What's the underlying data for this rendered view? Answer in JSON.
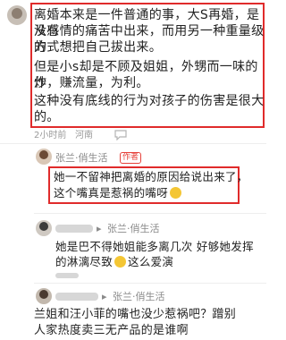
{
  "comment1": {
    "lines": [
      "离婚本来是一件普通的事，大S再婚，是没有",
      "从感情的痛苦中出来，而用另一种重量级的",
      "方式想把自己拔出来。",
      "但是小s却是不顾及姐姐，外甥而一味的炒",
      "作，赚流量，为利。",
      "这种没有底线的行为对孩子的伤害是很大",
      "的。"
    ],
    "time": "2小时前",
    "location": "河南"
  },
  "reply1": {
    "name": "张兰·俏生活",
    "badge": "作者",
    "lines": [
      "她一不留神把离婚的原因给说出来了，",
      "这个嘴真是惹祸的嘴呀"
    ]
  },
  "reply2": {
    "arrow": "▸",
    "name": "张兰·俏生活",
    "lines": [
      "她是巴不得她姐能多离几次 好够她发挥",
      "的淋漓尽致",
      "这么爱演"
    ]
  },
  "reply3": {
    "arrow": "▸",
    "name": "张兰·俏生活",
    "lines": [
      "兰姐和汪小菲的嘴也没少惹祸吧？蹭别",
      "人家热度卖三无产品的是谁啊"
    ]
  }
}
